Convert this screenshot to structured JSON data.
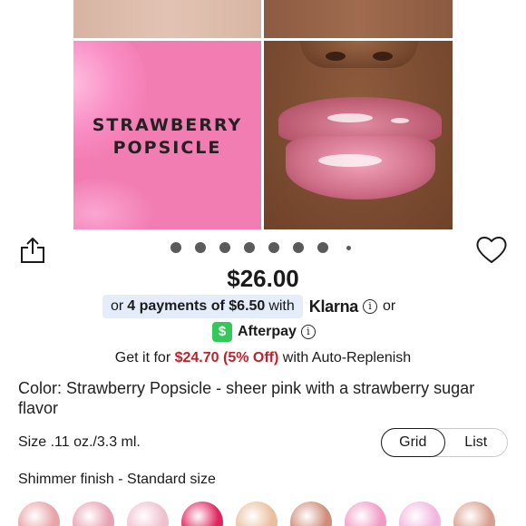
{
  "hero": {
    "shade_line1": "STRAWBERRY",
    "shade_line2": "POPSICLE",
    "total_slides": 8,
    "active_slide": 1
  },
  "price": "$26.00",
  "klarna": {
    "prefix": "or",
    "payments": "4 payments of $6.50",
    "with": "with",
    "logo": "Klarna",
    "suffix": "or",
    "pill_color": "#e4edf9"
  },
  "afterpay": {
    "logo_glyph": "$",
    "label": "Afterpay",
    "icon_color": "#34c759"
  },
  "replenish": {
    "prefix": "Get it for",
    "discount": "$24.70 (5% Off)",
    "suffix": "with Auto-Replenish",
    "discount_color": "#c0202a"
  },
  "color": "Color: Strawberry Popsicle - sheer pink with a strawberry sugar flavor",
  "size": "Size .11 oz./3.3 ml.",
  "view_toggle": {
    "options": [
      "Grid",
      "List"
    ],
    "selected": "Grid"
  },
  "finish": "Shimmer finish - Standard size",
  "swatch_colors": [
    "#e8a3a8",
    "#e7a2b3",
    "#f0c0cf",
    "#e0245e",
    "#e9bf9e",
    "#cf8c79",
    "#f29ac4",
    "#f3b6de",
    "#d9a08f"
  ],
  "icons": {
    "share": "share-icon",
    "heart": "heart-icon",
    "info": "info-icon"
  }
}
